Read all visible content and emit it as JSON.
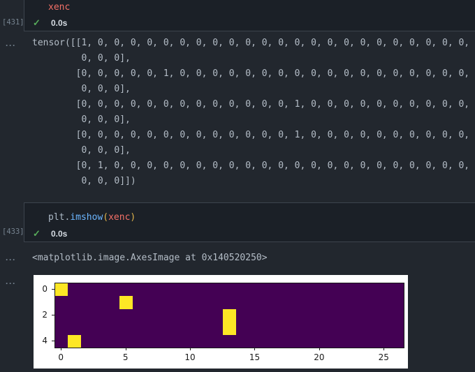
{
  "theme": {
    "page_bg": "#22272e",
    "cell_bg": "#1b2027",
    "cell_border": "#3d444d",
    "code_fg": "#adbac7",
    "output_fg": "#b4bdc7",
    "muted": "#768390",
    "time_fg": "#d6dce3",
    "red": "#f47067",
    "blue": "#6cb6ff",
    "gold": "#e0b44c",
    "green": "#57ab5a",
    "figure_bg": "#ffffff",
    "axis_fg": "#1a1a1a",
    "viridis_low": "#440154",
    "viridis_high": "#fde725"
  },
  "cells": [
    {
      "execution_count": "[431]",
      "status_time": "0.0s",
      "code_tokens": [
        {
          "text": "xenc",
          "color": "red"
        }
      ]
    },
    {
      "execution_count": "[433]",
      "status_time": "0.0s",
      "code_tokens": [
        {
          "text": "plt",
          "color": "code_fg"
        },
        {
          "text": ".",
          "color": "code_fg"
        },
        {
          "text": "imshow",
          "color": "blue"
        },
        {
          "text": "(",
          "color": "gold"
        },
        {
          "text": "xenc",
          "color": "red"
        },
        {
          "text": ")",
          "color": "gold"
        }
      ]
    }
  ],
  "outputs": {
    "collapse_glyph": "···",
    "tensor_lines": [
      "tensor([[1, 0, 0, 0, 0, 0, 0, 0, 0, 0, 0, 0, 0, 0, 0, 0, 0, 0, 0, 0, 0, 0, 0, 0,",
      "         0, 0, 0],",
      "        [0, 0, 0, 0, 0, 1, 0, 0, 0, 0, 0, 0, 0, 0, 0, 0, 0, 0, 0, 0, 0, 0, 0, 0,",
      "         0, 0, 0],",
      "        [0, 0, 0, 0, 0, 0, 0, 0, 0, 0, 0, 0, 0, 1, 0, 0, 0, 0, 0, 0, 0, 0, 0, 0,",
      "         0, 0, 0],",
      "        [0, 0, 0, 0, 0, 0, 0, 0, 0, 0, 0, 0, 0, 1, 0, 0, 0, 0, 0, 0, 0, 0, 0, 0,",
      "         0, 0, 0],",
      "        [0, 1, 0, 0, 0, 0, 0, 0, 0, 0, 0, 0, 0, 0, 0, 0, 0, 0, 0, 0, 0, 0, 0, 0,",
      "         0, 0, 0]])"
    ],
    "repr_text": "<matplotlib.image.AxesImage at 0x140520250>"
  },
  "chart_data": {
    "type": "heatmap",
    "title": "",
    "colormap": "viridis",
    "shape": [
      5,
      27
    ],
    "ones": [
      [
        0,
        0
      ],
      [
        1,
        5
      ],
      [
        2,
        13
      ],
      [
        3,
        13
      ],
      [
        4,
        1
      ]
    ],
    "x_ticks": [
      0,
      5,
      10,
      15,
      20,
      25
    ],
    "y_ticks": [
      0,
      2,
      4
    ],
    "x_range": [
      -0.5,
      26.5
    ],
    "y_range": [
      4.5,
      -0.5
    ],
    "value_colors": {
      "0": "#440154",
      "1": "#fde725"
    },
    "grid": false,
    "legend": "none"
  }
}
